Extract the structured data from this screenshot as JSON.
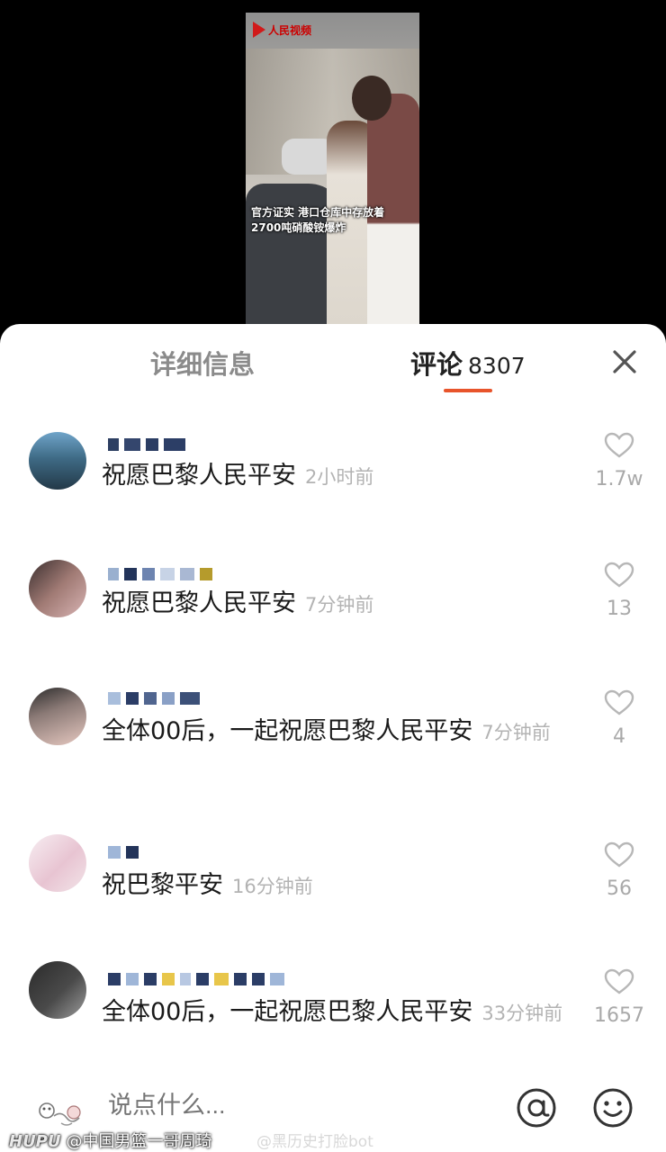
{
  "video": {
    "logo_text": "人民视频",
    "caption": "官方证实 港口仓库中存放着2700吨硝酸铵爆炸"
  },
  "tabs": {
    "info_label": "详细信息",
    "comments_label": "评论",
    "comments_count": "8307",
    "accent_color": "#e8542b"
  },
  "comments": [
    {
      "text": "祝愿巴黎人民平安",
      "time": "2小时前",
      "likes": "1.7w"
    },
    {
      "text": "祝愿巴黎人民平安",
      "time": "7分钟前",
      "likes": "13"
    },
    {
      "text": "全体00后，一起祝愿巴黎人民平安",
      "time": "7分钟前",
      "likes": "4"
    },
    {
      "text": "祝巴黎平安",
      "time": "16分钟前",
      "likes": "56"
    },
    {
      "text": "全体00后，一起祝愿巴黎人民平安",
      "time": "33分钟前",
      "likes": "1657"
    }
  ],
  "bottom_bar": {
    "placeholder": "说点什么...",
    "icons": [
      "sticker-icon",
      "at-icon",
      "emoji-icon"
    ]
  },
  "watermarks": {
    "left_brand": "HUPU",
    "left_text": "@中国男篮一哥周琦",
    "right_text": "@黑历史打脸bot"
  }
}
